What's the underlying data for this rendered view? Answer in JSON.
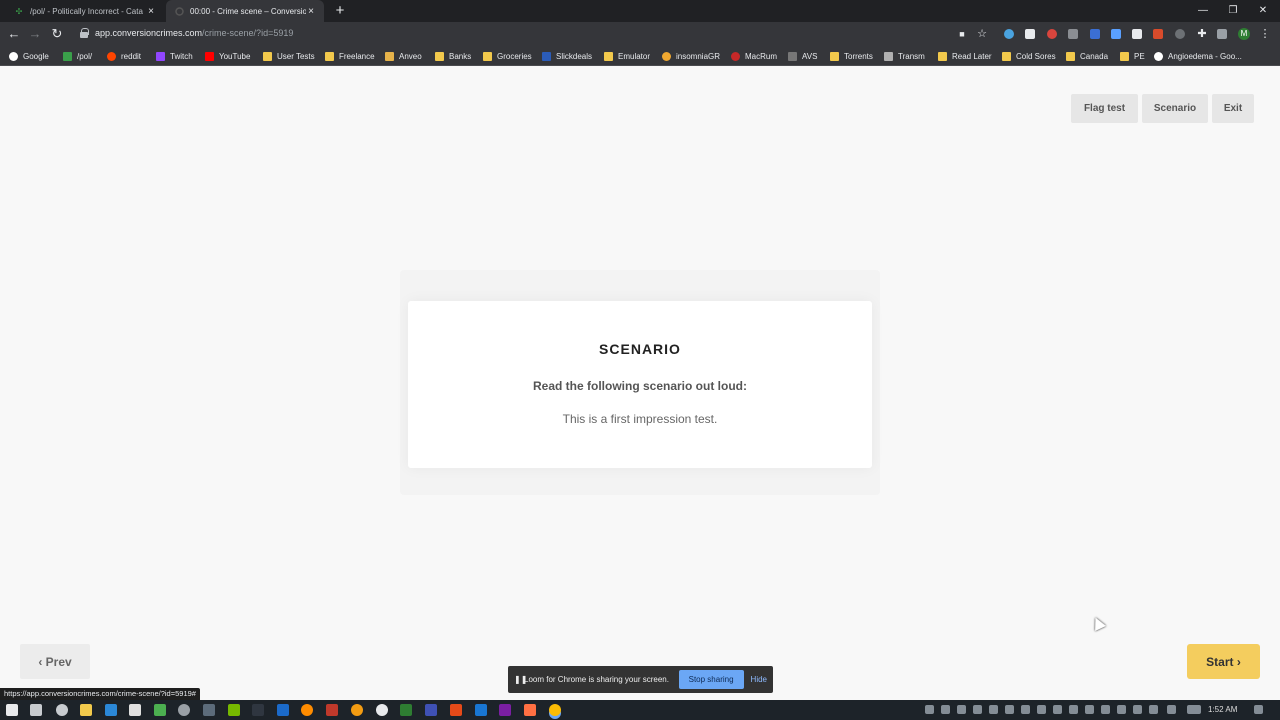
{
  "browser": {
    "tabs": [
      {
        "title": "/pol/ - Politically Incorrect - Cata",
        "active": false
      },
      {
        "title": "00:00 - Crime scene – Conversion",
        "active": true
      }
    ],
    "new_tab_icon": "plus-icon",
    "url_host": "app.conversioncrimes.com",
    "url_path": "/crime-scene/?id=5919",
    "profile_initial": "M",
    "bookmarks": [
      "Google",
      "/pol/",
      "reddit",
      "Twitch",
      "YouTube",
      "User Tests",
      "Freelance",
      "Anveo",
      "Banks",
      "Groceries",
      "Slickdeals",
      "Emulator",
      "insomniaGR",
      "MacRum",
      "AVS",
      "Torrents",
      "Transm",
      "Read Later",
      "Cold Sores",
      "Canada",
      "PE",
      "Angioedema - Goo..."
    ],
    "status_url": "https://app.conversioncrimes.com/crime-scene/?id=5919#"
  },
  "header": {
    "flag_test": "Flag test",
    "scenario": "Scenario",
    "exit": "Exit"
  },
  "card": {
    "title": "SCENARIO",
    "instruction": "Read the following scenario out loud:",
    "body": "This is a first impression test."
  },
  "footer": {
    "prev": "‹ Prev",
    "start": "Start ›"
  },
  "loom": {
    "message": "Loom for Chrome is sharing your screen.",
    "stop": "Stop sharing",
    "hide": "Hide"
  },
  "taskbar": {
    "time": "1:52 AM"
  },
  "colors": {
    "start_button": "#f4cd5e",
    "page_bg": "#f8f8f8",
    "loom_stop": "#6ba7f5"
  }
}
